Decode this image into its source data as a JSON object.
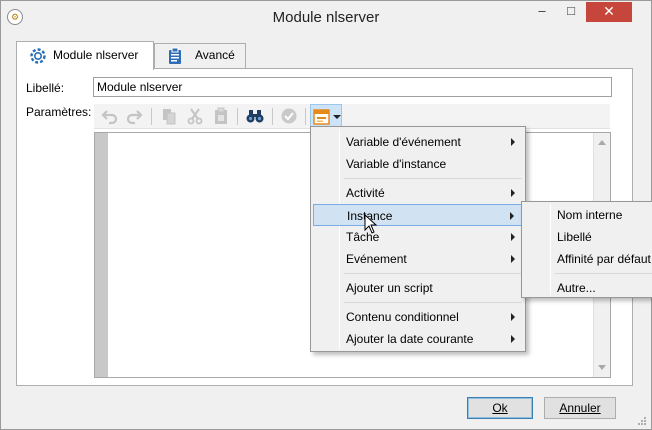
{
  "window": {
    "title": "Module nlserver",
    "app_icon": "ncs-app-icon",
    "controls": {
      "minimize": "–",
      "maximize": "□",
      "close": "✕"
    }
  },
  "tabs": [
    {
      "label": "Module nlserver",
      "icon": "module-gear-icon",
      "active": true
    },
    {
      "label": "Avancé",
      "icon": "clipboard-icon",
      "active": false
    }
  ],
  "form": {
    "libelle_label": "Libellé:",
    "libelle_value": "Module nlserver",
    "parametres_label": "Paramètres:"
  },
  "toolbar": {
    "icons": [
      "undo-icon",
      "redo-icon",
      "copy-icon",
      "cut-icon",
      "paste-icon",
      "binoculars-icon",
      "checkmark-icon",
      "insert-field-icon",
      "dropdown-arrow-icon"
    ]
  },
  "context_menu": {
    "items": [
      {
        "label": "Variable d'événement",
        "submenu": true
      },
      {
        "label": "Variable d'instance",
        "submenu": false
      },
      {
        "label": "Activité",
        "submenu": true
      },
      {
        "label": "Instance",
        "submenu": true,
        "highlighted": true
      },
      {
        "label": "Tâche",
        "submenu": true
      },
      {
        "label": "Evénement",
        "submenu": true
      },
      {
        "label": "Ajouter un script",
        "submenu": false
      },
      {
        "label": "Contenu conditionnel",
        "submenu": true
      },
      {
        "label": "Ajouter la date courante",
        "submenu": true
      }
    ]
  },
  "submenu": {
    "items": [
      {
        "label": "Nom interne"
      },
      {
        "label": "Libellé"
      },
      {
        "label": "Affinité par défaut"
      },
      {
        "label": "Autre..."
      }
    ]
  },
  "buttons": {
    "ok": "Ok",
    "cancel": "Annuler"
  },
  "colors": {
    "close_button": "#c7463b",
    "highlight": "#d1e2f2",
    "highlight_border": "#78aee5"
  }
}
